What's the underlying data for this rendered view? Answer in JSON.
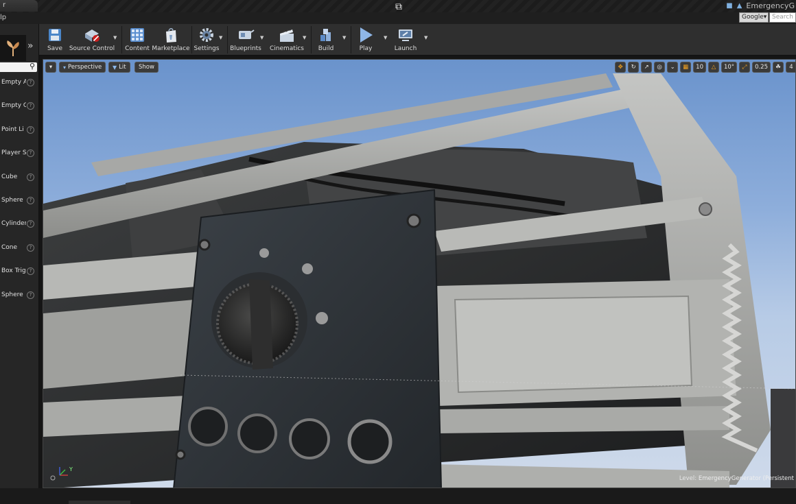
{
  "titlebar": {
    "tab_label": "r",
    "project_name": "EmergencyG",
    "restore_icon": "window-restore-icon"
  },
  "menubar": {
    "help_label": "lp",
    "search_engine": "Google",
    "search_placeholder": "Search F"
  },
  "toolbar": {
    "save": "Save",
    "source_control": "Source Control",
    "content": "Content",
    "marketplace": "Marketplace",
    "settings": "Settings",
    "blueprints": "Blueprints",
    "cinematics": "Cinematics",
    "build": "Build",
    "play": "Play",
    "launch": "Launch"
  },
  "place_panel": {
    "items": [
      {
        "label": "Empty A"
      },
      {
        "label": "Empty C"
      },
      {
        "label": "Point Li"
      },
      {
        "label": "Player S"
      },
      {
        "label": "Cube"
      },
      {
        "label": "Sphere"
      },
      {
        "label": "Cylinder"
      },
      {
        "label": "Cone"
      },
      {
        "label": "Box Trig"
      },
      {
        "label": "Sphere"
      }
    ]
  },
  "viewport": {
    "perspective": "Perspective",
    "lit": "Lit",
    "show": "Show",
    "grid_snap": "10",
    "rotation_snap": "10°",
    "scale_snap": "0.25",
    "camera_speed": "4",
    "level_prefix": "Level:",
    "level_name": "EmergencyGenerator (Persistent",
    "colors": {
      "sky_top": "#6a93cc",
      "metal_frame": "#a9aaa8",
      "dark_panel": "#2b2f33",
      "snap_orange": "#f0a020"
    }
  }
}
